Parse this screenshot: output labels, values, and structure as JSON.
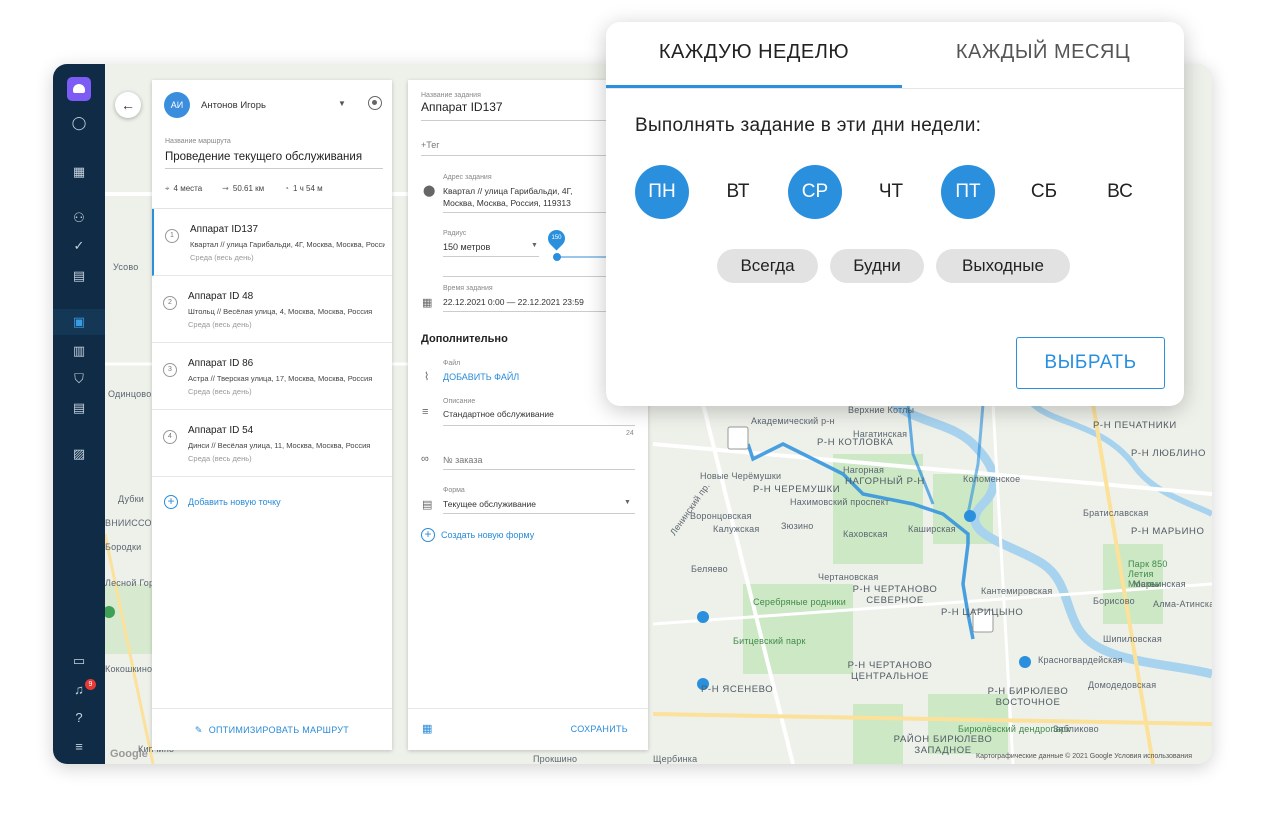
{
  "sidebar": {
    "notifications_count": "9"
  },
  "route_panel": {
    "avatar_initials": "АИ",
    "user_name": "Антонов Игорь",
    "route_name_label": "Название маршрута",
    "route_name": "Проведение текущего обслуживания",
    "stats": {
      "places": "4 места",
      "distance": "50.61 км",
      "duration": "1 ч 54 м"
    },
    "stops": [
      {
        "num": "1",
        "title": "Аппарат ID137",
        "address": "Квартал // улица Гарибальди, 4Г, Москва, Москва, Россия",
        "schedule": "Среда (весь день)"
      },
      {
        "num": "2",
        "title": "Аппарат ID 48",
        "address": "Штольц // Весёлая улица, 4, Москва, Москва, Россия",
        "schedule": "Среда (весь день)"
      },
      {
        "num": "3",
        "title": "Аппарат ID 86",
        "address": "Астра // Тверская улица, 17, Москва, Москва, Россия",
        "schedule": "Среда (весь день)"
      },
      {
        "num": "4",
        "title": "Аппарат ID 54",
        "address": "Динси // Весёлая улица, 11, Москва, Москва, Россия",
        "schedule": "Среда (весь день)"
      }
    ],
    "add_point": "Добавить новую точку",
    "optimize": "ОПТИМИЗИРОВАТЬ МАРШРУТ"
  },
  "task_panel": {
    "task_name_label": "Название задания",
    "task_name": "Аппарат ID137",
    "tag_placeholder": "+Тег",
    "address_label": "Адрес задания",
    "address_line1": "Квартал // улица Гарибальди, 4Г,",
    "address_line2": "Москва, Москва, Россия, 119313",
    "radius_label": "Радиус",
    "radius_value": "150 метров",
    "slider_value": "150",
    "time_label": "Время задания",
    "time_value": "22.12.2021 0:00 — 22.12.2021 23:59",
    "additional_title": "Дополнительно",
    "file_label": "Файл",
    "add_file": "ДОБАВИТЬ ФАЙЛ",
    "description_label": "Описание",
    "description": "Стандартное обслуживание",
    "description_count": "24",
    "order_placeholder": "№ заказа",
    "form_label": "Форма",
    "form_value": "Текущее обслуживание",
    "create_form": "Создать новую форму",
    "save": "СОХРАНИТЬ"
  },
  "schedule_popup": {
    "tab_week": "КАЖДУЮ НЕДЕЛЮ",
    "tab_month": "КАЖДЫЙ МЕСЯЦ",
    "active_tab": "week",
    "prompt": "Выполнять задание в эти дни недели:",
    "days": [
      {
        "label": "ПН",
        "selected": true
      },
      {
        "label": "ВТ",
        "selected": false
      },
      {
        "label": "СР",
        "selected": true
      },
      {
        "label": "ЧТ",
        "selected": false
      },
      {
        "label": "ПТ",
        "selected": true
      },
      {
        "label": "СБ",
        "selected": false
      },
      {
        "label": "ВС",
        "selected": false
      }
    ],
    "presets": [
      "Всегда",
      "Будни",
      "Выходные"
    ],
    "select_button": "ВЫБРАТЬ"
  },
  "map": {
    "labels": [
      "Академический р-н",
      "Р-Н КОТЛОВКА",
      "Нагатинская",
      "Нагорная",
      "НАГОРНЫЙ Р-Н",
      "Р-Н ЧЕРЕМУШКИ",
      "Нахимовский проспект",
      "Новые Черёмушки",
      "Воронцовская",
      "Калужская",
      "Зюзино",
      "Каховская",
      "Каширская",
      "Беляево",
      "Кантемировская",
      "Р-Н ЧЕРТАНОВО СЕВЕРНОЕ",
      "Чертановская",
      "Р-Н ЦАРИЦЫНО",
      "Р-Н ЧЕРТАНОВО ЦЕНТРАЛЬНОЕ",
      "Р-Н ЯСЕНЕВО",
      "Р-Н БИРЮЛЕВО ВОСТОЧНОЕ",
      "РАЙОН БИРЮЛЕВО ЗАПАДНОЕ",
      "Р-Н ПЕЧАТНИКИ",
      "Р-Н ЛЮБЛИНО",
      "Р-Н МАРЬИНО",
      "Братиславская",
      "Борисово",
      "Шипиловская",
      "Домодедовская",
      "Красногвардейская",
      "Коломенское",
      "Верхние Котлы",
      "Парк 850 Летия Москвы",
      "Битцевский парк",
      "Бирюлёвский дендропарк",
      "Усово",
      "Одинцово",
      "Дубки",
      "ВНИИССОК",
      "Лесной Городок",
      "Кокошкино",
      "Прокшино",
      "Кипчино",
      "Щербинка",
      "Бородки",
      "Серебряные родники",
      "Ленинский пр.",
      "Зябликово",
      "Алма-Атинская",
      "Марьинская"
    ],
    "footer": "Картографические данные © 2021 Google   Условия использования",
    "google": "Google"
  }
}
